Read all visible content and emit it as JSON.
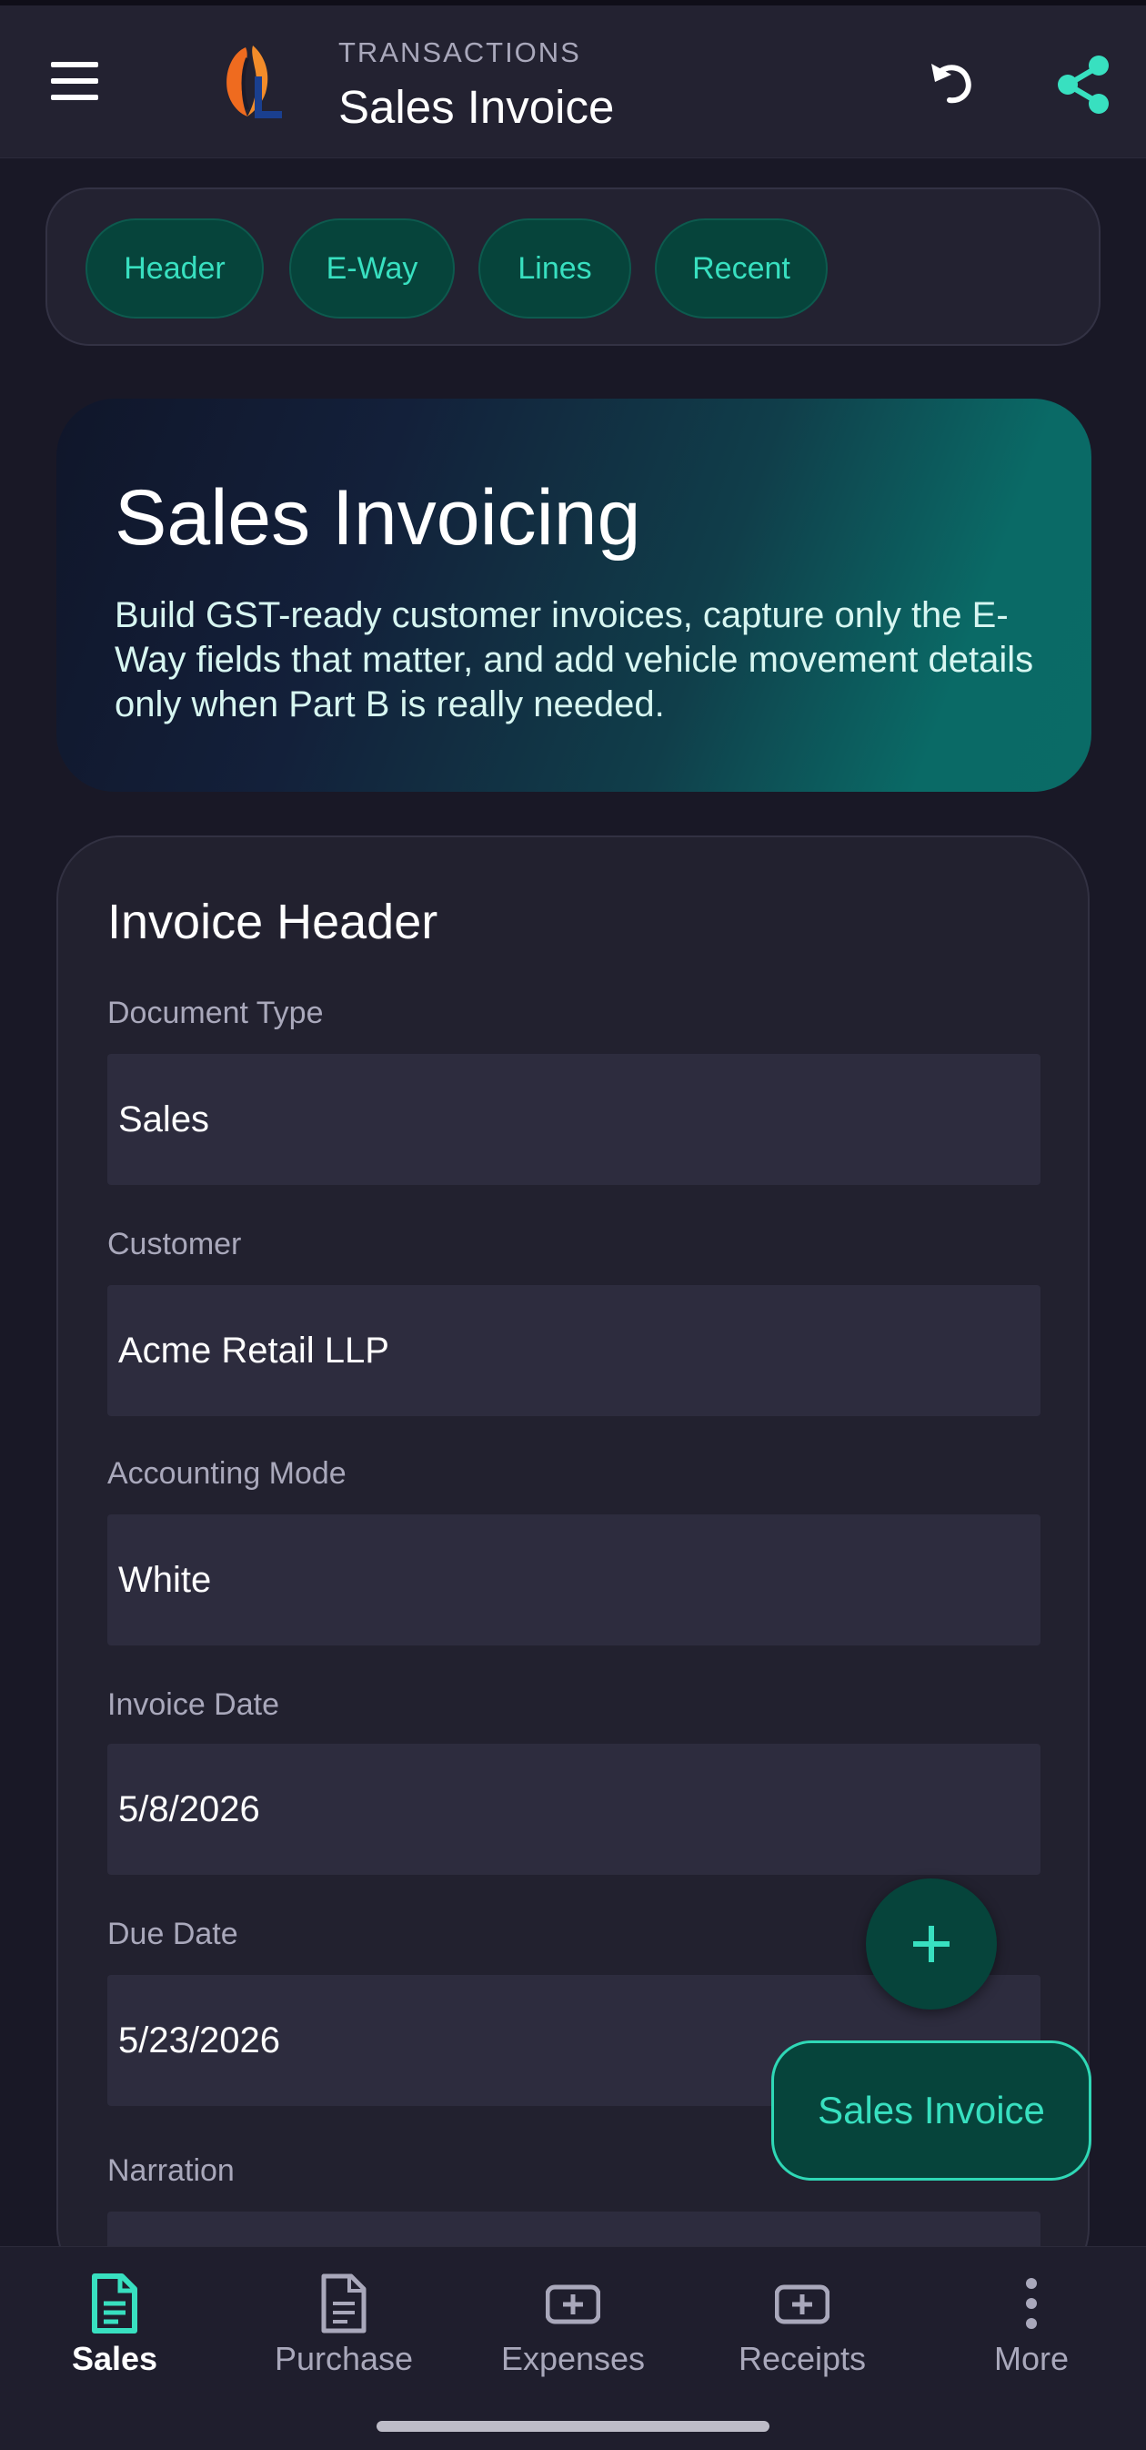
{
  "app_bar": {
    "kicker": "TRANSACTIONS",
    "title": "Sales Invoice",
    "icons": [
      "menu-icon",
      "app-logo",
      "undo-icon",
      "share-icon"
    ]
  },
  "section_chips": [
    "Header",
    "E-Way",
    "Lines",
    "Recent"
  ],
  "hero": {
    "title": "Sales Invoicing",
    "description": "Build GST-ready customer invoices, capture only the E-Way fields that matter, and add vehicle movement details only when Part B is really needed."
  },
  "invoice_header": {
    "title": "Invoice Header",
    "fields": [
      {
        "label": "Document Type",
        "value": "Sales"
      },
      {
        "label": "Customer",
        "value": "Acme Retail LLP"
      },
      {
        "label": "Accounting Mode",
        "value": "White"
      },
      {
        "label": "Invoice Date",
        "value": "5/8/2026"
      },
      {
        "label": "Due Date",
        "value": "5/23/2026"
      },
      {
        "label": "Narration",
        "value": ""
      }
    ]
  },
  "fab": {
    "icon": "plus-icon",
    "extended_label": "Sales Invoice"
  },
  "bottom_nav": {
    "active": "Sales",
    "items": [
      {
        "label": "Sales",
        "icon": "document-icon"
      },
      {
        "label": "Purchase",
        "icon": "document-icon"
      },
      {
        "label": "Expenses",
        "icon": "plus-box-icon"
      },
      {
        "label": "Receipts",
        "icon": "plus-box-icon"
      },
      {
        "label": "More",
        "icon": "more-vertical-icon"
      }
    ]
  },
  "colors": {
    "accent": "#38e0c0",
    "chip_bg": "#06443b",
    "background": "#191826",
    "surface": "#22212f",
    "field_bg": "#2d2c3e"
  }
}
